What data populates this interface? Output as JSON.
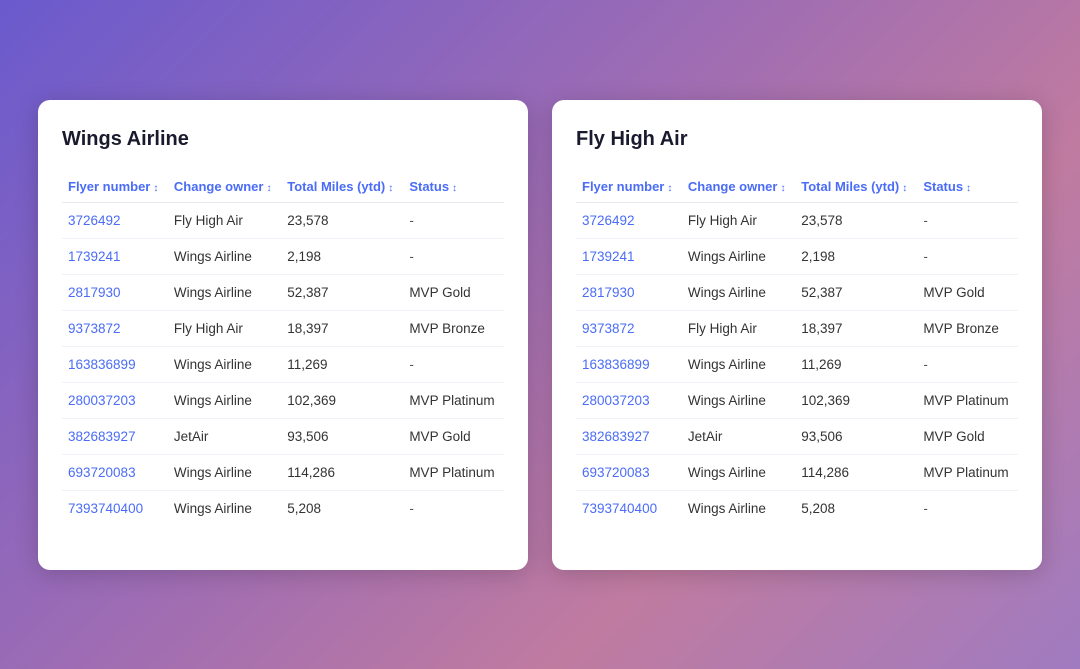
{
  "tables": [
    {
      "id": "wings-airline",
      "title": "Wings Airline",
      "columns": [
        {
          "key": "flyer",
          "label": "Flyer number",
          "sortable": true
        },
        {
          "key": "owner",
          "label": "Change owner",
          "sortable": true
        },
        {
          "key": "miles",
          "label": "Total Miles (ytd)",
          "sortable": true
        },
        {
          "key": "status",
          "label": "Status",
          "sortable": true
        }
      ],
      "rows": [
        {
          "flyer": "3726492",
          "owner": "Fly High Air",
          "miles": "23,578",
          "status": "-"
        },
        {
          "flyer": "1739241",
          "owner": "Wings Airline",
          "miles": "2,198",
          "status": "-"
        },
        {
          "flyer": "2817930",
          "owner": "Wings Airline",
          "miles": "52,387",
          "status": "MVP Gold"
        },
        {
          "flyer": "9373872",
          "owner": "Fly High Air",
          "miles": "18,397",
          "status": "MVP Bronze"
        },
        {
          "flyer": "163836899",
          "owner": "Wings Airline",
          "miles": "11,269",
          "status": "-"
        },
        {
          "flyer": "280037203",
          "owner": "Wings Airline",
          "miles": "102,369",
          "status": "MVP Platinum"
        },
        {
          "flyer": "382683927",
          "owner": "JetAir",
          "miles": "93,506",
          "status": "MVP Gold"
        },
        {
          "flyer": "693720083",
          "owner": "Wings Airline",
          "miles": "114,286",
          "status": "MVP Platinum"
        },
        {
          "flyer": "7393740400",
          "owner": "Wings Airline",
          "miles": "5,208",
          "status": "-"
        }
      ]
    },
    {
      "id": "fly-high-air",
      "title": "Fly High Air",
      "columns": [
        {
          "key": "flyer",
          "label": "Flyer number",
          "sortable": true
        },
        {
          "key": "owner",
          "label": "Change owner",
          "sortable": true
        },
        {
          "key": "miles",
          "label": "Total Miles (ytd)",
          "sortable": true
        },
        {
          "key": "status",
          "label": "Status",
          "sortable": true
        }
      ],
      "rows": [
        {
          "flyer": "3726492",
          "owner": "Fly High Air",
          "miles": "23,578",
          "status": "-"
        },
        {
          "flyer": "1739241",
          "owner": "Wings Airline",
          "miles": "2,198",
          "status": "-"
        },
        {
          "flyer": "2817930",
          "owner": "Wings Airline",
          "miles": "52,387",
          "status": "MVP Gold"
        },
        {
          "flyer": "9373872",
          "owner": "Fly High Air",
          "miles": "18,397",
          "status": "MVP Bronze"
        },
        {
          "flyer": "163836899",
          "owner": "Wings Airline",
          "miles": "11,269",
          "status": "-"
        },
        {
          "flyer": "280037203",
          "owner": "Wings Airline",
          "miles": "102,369",
          "status": "MVP Platinum"
        },
        {
          "flyer": "382683927",
          "owner": "JetAir",
          "miles": "93,506",
          "status": "MVP Gold"
        },
        {
          "flyer": "693720083",
          "owner": "Wings Airline",
          "miles": "114,286",
          "status": "MVP Platinum"
        },
        {
          "flyer": "7393740400",
          "owner": "Wings Airline",
          "miles": "5,208",
          "status": "-"
        }
      ]
    }
  ],
  "sort_icon": "↕"
}
